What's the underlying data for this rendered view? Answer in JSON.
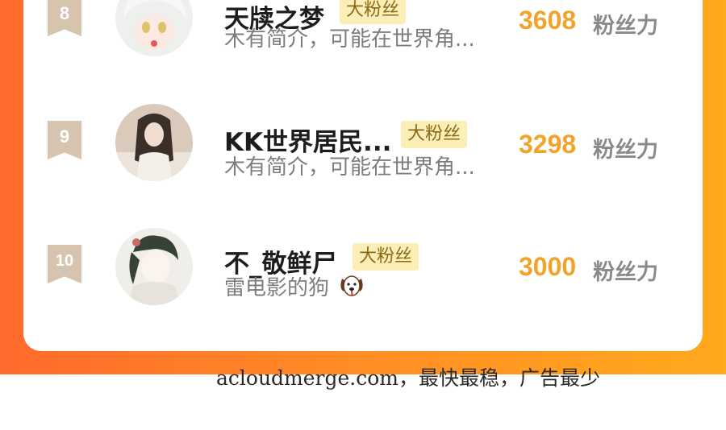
{
  "list": {
    "items": [
      {
        "rank": "8",
        "name": "天牍之梦",
        "badge": "大粉丝",
        "desc": "木有简介，可能在世界角...",
        "score": "3608",
        "unit": "粉丝力"
      },
      {
        "rank": "9",
        "name": "KK世界居民...",
        "badge": "大粉丝",
        "desc": "木有简介，可能在世界角...",
        "score": "3298",
        "unit": "粉丝力"
      },
      {
        "rank": "10",
        "name": "不_敬鲜尸",
        "badge": "大粉丝",
        "desc": "雷电影的狗",
        "score": "3000",
        "unit": "粉丝力"
      }
    ]
  },
  "footer": {
    "watermark": "acloudmerge.com，最快最稳，广告最少"
  },
  "colors": {
    "banner": "#ff8a25",
    "score": "#f1a42b",
    "badge_bg": "#fbefb6",
    "rank_bg": "#d7c4ae"
  },
  "icons": {
    "desc_emoji": "dog-face-icon"
  }
}
